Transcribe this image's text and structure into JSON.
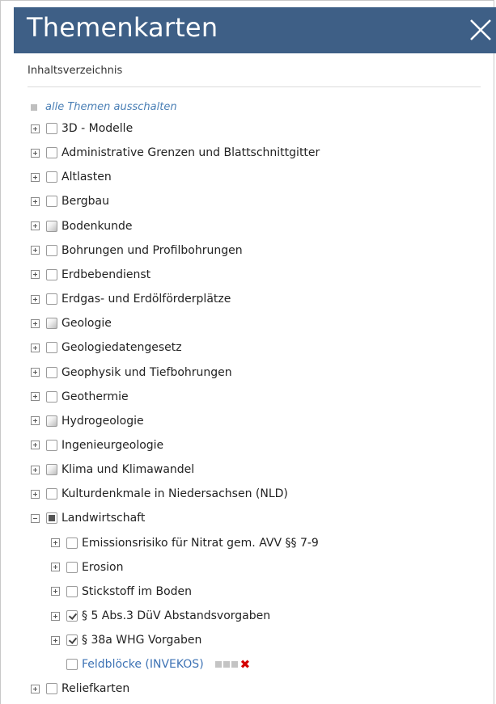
{
  "header": {
    "title": "Themenkarten"
  },
  "toc": {
    "heading": "Inhaltsverzeichnis",
    "toggle_all": "alle Themen ausschalten"
  },
  "items": [
    {
      "label": "3D - Modelle",
      "state": "unchecked"
    },
    {
      "label": "Administrative Grenzen und Blattschnittgitter",
      "state": "unchecked"
    },
    {
      "label": "Altlasten",
      "state": "unchecked"
    },
    {
      "label": "Bergbau",
      "state": "unchecked"
    },
    {
      "label": "Bodenkunde",
      "state": "partial"
    },
    {
      "label": "Bohrungen und Profilbohrungen",
      "state": "unchecked"
    },
    {
      "label": "Erdbebendienst",
      "state": "unchecked"
    },
    {
      "label": "Erdgas- und Erdölförderplätze",
      "state": "unchecked"
    },
    {
      "label": "Geologie",
      "state": "partial"
    },
    {
      "label": "Geologiedatengesetz",
      "state": "unchecked"
    },
    {
      "label": "Geophysik und Tiefbohrungen",
      "state": "unchecked"
    },
    {
      "label": "Geothermie",
      "state": "unchecked"
    },
    {
      "label": "Hydrogeologie",
      "state": "partial"
    },
    {
      "label": "Ingenieurgeologie",
      "state": "unchecked"
    },
    {
      "label": "Klima und Klimawandel",
      "state": "partial"
    },
    {
      "label": "Kulturdenkmale in Niedersachsen (NLD)",
      "state": "unchecked"
    },
    {
      "label": "Landwirtschaft",
      "state": "filled",
      "expanded": true
    },
    {
      "label": "Emissionsrisiko für Nitrat gem. AVV §§ 7-9",
      "state": "unchecked",
      "child": true
    },
    {
      "label": "Erosion",
      "state": "unchecked",
      "child": true
    },
    {
      "label": "Stickstoff im Boden",
      "state": "unchecked",
      "child": true
    },
    {
      "label": "§ 5 Abs.3 DüV Abstandsvorgaben",
      "state": "checked",
      "child": true
    },
    {
      "label": "§ 38a WHG Vorgaben",
      "state": "checked",
      "child": true
    },
    {
      "label": "Feldblöcke (INVEKOS)",
      "state": "unchecked",
      "child": true,
      "leaf": true,
      "link": true
    },
    {
      "label": "Reliefkarten",
      "state": "unchecked"
    }
  ],
  "colors": {
    "header": "#3e5f86",
    "link": "#3e73b5",
    "remove": "#d40000"
  }
}
